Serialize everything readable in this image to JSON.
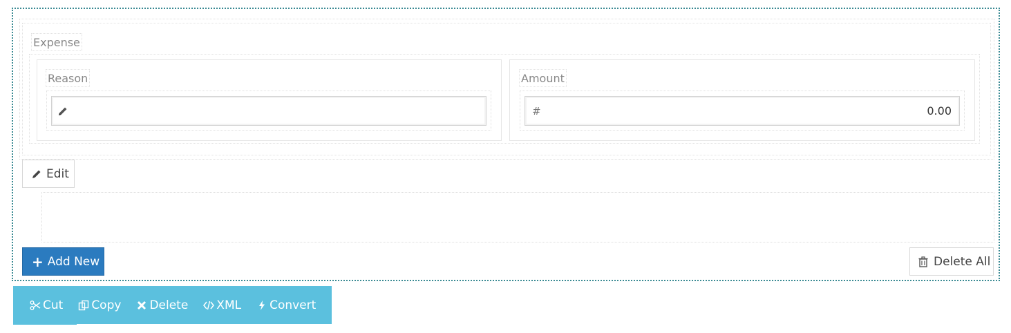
{
  "section": {
    "label": "Expense"
  },
  "fields": {
    "reason": {
      "label": "Reason",
      "value": "",
      "icon": "pencil-icon"
    },
    "amount": {
      "label": "Amount",
      "prefix": "#",
      "value": "0.00"
    }
  },
  "buttons": {
    "edit_label": "Edit",
    "add_new_label": "Add New",
    "delete_all_label": "Delete All"
  },
  "toolbar": {
    "cut": "Cut",
    "copy": "Copy",
    "delete": "Delete",
    "xml": "XML",
    "convert": "Convert"
  },
  "colors": {
    "primary_button": "#2b7bbf",
    "toolbar_bg": "#5bc0de",
    "selection_border": "#3a8a93"
  }
}
